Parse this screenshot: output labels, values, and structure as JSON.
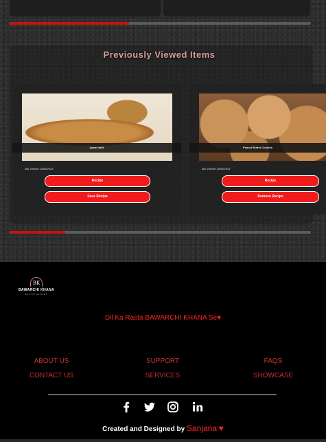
{
  "section": {
    "title": "Previously Viewed Items"
  },
  "items": [
    {
      "name": "Apam balik",
      "last_viewed": "last Viewed 16/08/2024",
      "primary_label": "Recipe",
      "secondary_label": "Save Recipe"
    },
    {
      "name": "Peanut Butter Cookies",
      "last_viewed": "last Viewed 15/08/2024",
      "primary_label": "Recipe",
      "secondary_label": "Remove Recipe"
    }
  ],
  "footer": {
    "logo_mark": "BK",
    "logo_text": "BAWARCHI KHANA",
    "logo_sub": "EXOTIC RECIPES",
    "tagline": "Dil Ka Rasta BAWARCHI KHANA Se",
    "tagline_heart": "♥",
    "links": {
      "about": "ABOUT US",
      "support": "SUPPORT",
      "faqs": "FAQS",
      "contact": "CONTACT US",
      "services": "SERVICES",
      "showcase": "SHOWCASE"
    },
    "social_icons": [
      "facebook-icon",
      "twitter-icon",
      "instagram-icon",
      "linkedin-icon"
    ],
    "credit_prefix": "Created and Designed by",
    "credit_name": "Sanjana",
    "credit_heart": "♥"
  },
  "colors": {
    "accent": "#f01c1c",
    "scroll_thumb": "#c01515",
    "footer_bg": "#000000"
  }
}
